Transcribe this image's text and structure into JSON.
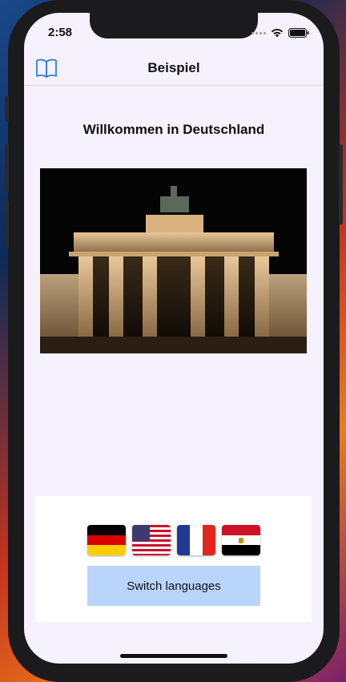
{
  "status_bar": {
    "time": "2:58",
    "icons": [
      "cellular-dots-icon",
      "wifi-icon",
      "battery-icon"
    ]
  },
  "navbar": {
    "title": "Beispiel",
    "left_icon": "book-icon"
  },
  "content": {
    "heading": "Willkommen in Deutschland",
    "image_subject": "brandenburg-gate-night"
  },
  "language_panel": {
    "flags": [
      {
        "id": "de",
        "icon": "germany-flag-icon"
      },
      {
        "id": "us",
        "icon": "usa-flag-icon"
      },
      {
        "id": "fr",
        "icon": "france-flag-icon"
      },
      {
        "id": "eg",
        "icon": "egypt-flag-icon"
      }
    ],
    "switch_label": "Switch languages"
  },
  "colors": {
    "accent": "#2f7de1",
    "button_bg": "#b9d5fc",
    "screen_bg": "#f5f2fd"
  }
}
